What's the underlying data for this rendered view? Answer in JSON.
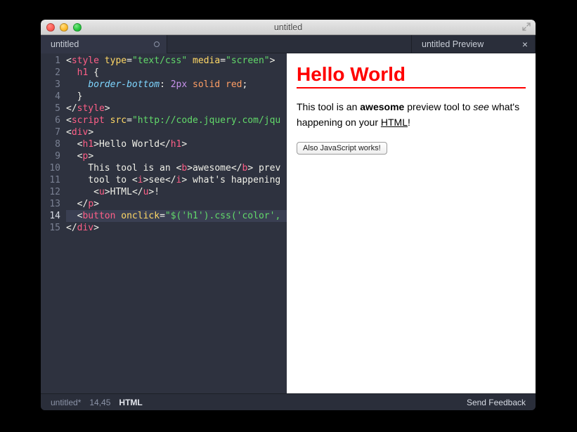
{
  "window": {
    "title": "untitled"
  },
  "tabs": {
    "left": {
      "label": "untitled",
      "dirty": true
    },
    "right": {
      "label": "untitled Preview"
    }
  },
  "editor": {
    "current_line": 14,
    "lines": [
      {
        "n": "1",
        "seg": [
          [
            "ang",
            "<"
          ],
          [
            "tag",
            "style"
          ],
          [
            "text",
            " "
          ],
          [
            "attr",
            "type"
          ],
          [
            "ang",
            "="
          ],
          [
            "str",
            "\"text/css\""
          ],
          [
            "text",
            " "
          ],
          [
            "attr",
            "media"
          ],
          [
            "ang",
            "="
          ],
          [
            "str",
            "\"screen\""
          ],
          [
            "ang",
            ">"
          ]
        ]
      },
      {
        "n": "2",
        "seg": [
          [
            "text",
            "  "
          ],
          [
            "tag",
            "h1"
          ],
          [
            "text",
            " {"
          ]
        ]
      },
      {
        "n": "3",
        "seg": [
          [
            "text",
            "    "
          ],
          [
            "prop",
            "border-bottom"
          ],
          [
            "text",
            ": "
          ],
          [
            "num",
            "2px"
          ],
          [
            "text",
            " "
          ],
          [
            "key",
            "solid"
          ],
          [
            "text",
            " "
          ],
          [
            "key",
            "red"
          ],
          [
            "text",
            ";"
          ]
        ]
      },
      {
        "n": "4",
        "seg": [
          [
            "text",
            "  }"
          ]
        ]
      },
      {
        "n": "5",
        "seg": [
          [
            "ang",
            "</"
          ],
          [
            "tag",
            "style"
          ],
          [
            "ang",
            ">"
          ]
        ]
      },
      {
        "n": "6",
        "seg": [
          [
            "ang",
            "<"
          ],
          [
            "tag",
            "script"
          ],
          [
            "text",
            " "
          ],
          [
            "attr",
            "src"
          ],
          [
            "ang",
            "="
          ],
          [
            "str",
            "\"http://code.jquery.com/jqu"
          ]
        ]
      },
      {
        "n": "7",
        "seg": [
          [
            "ang",
            "<"
          ],
          [
            "tag",
            "div"
          ],
          [
            "ang",
            ">"
          ]
        ]
      },
      {
        "n": "8",
        "seg": [
          [
            "text",
            "  "
          ],
          [
            "ang",
            "<"
          ],
          [
            "tag",
            "h1"
          ],
          [
            "ang",
            ">"
          ],
          [
            "text",
            "Hello World"
          ],
          [
            "ang",
            "</"
          ],
          [
            "tag",
            "h1"
          ],
          [
            "ang",
            ">"
          ]
        ]
      },
      {
        "n": "9",
        "seg": [
          [
            "text",
            "  "
          ],
          [
            "ang",
            "<"
          ],
          [
            "tag",
            "p"
          ],
          [
            "ang",
            ">"
          ]
        ]
      },
      {
        "n": "10",
        "seg": [
          [
            "text",
            "    This tool is an "
          ],
          [
            "ang",
            "<"
          ],
          [
            "tag",
            "b"
          ],
          [
            "ang",
            ">"
          ],
          [
            "text",
            "awesome"
          ],
          [
            "ang",
            "</"
          ],
          [
            "tag",
            "b"
          ],
          [
            "ang",
            ">"
          ],
          [
            "text",
            " prev"
          ]
        ]
      },
      {
        "n": "11",
        "seg": [
          [
            "text",
            "    tool to "
          ],
          [
            "ang",
            "<"
          ],
          [
            "tag",
            "i"
          ],
          [
            "ang",
            ">"
          ],
          [
            "text",
            "see"
          ],
          [
            "ang",
            "</"
          ],
          [
            "tag",
            "i"
          ],
          [
            "ang",
            ">"
          ],
          [
            "text",
            " what's happening"
          ]
        ]
      },
      {
        "n": "12",
        "seg": [
          [
            "text",
            "     "
          ],
          [
            "ang",
            "<"
          ],
          [
            "tag",
            "u"
          ],
          [
            "ang",
            ">"
          ],
          [
            "text",
            "HTML"
          ],
          [
            "ang",
            "</"
          ],
          [
            "tag",
            "u"
          ],
          [
            "ang",
            ">"
          ],
          [
            "text",
            "!"
          ]
        ]
      },
      {
        "n": "13",
        "seg": [
          [
            "text",
            "  "
          ],
          [
            "ang",
            "</"
          ],
          [
            "tag",
            "p"
          ],
          [
            "ang",
            ">"
          ]
        ]
      },
      {
        "n": "14",
        "seg": [
          [
            "text",
            "  "
          ],
          [
            "ang",
            "<"
          ],
          [
            "tag",
            "button"
          ],
          [
            "text",
            " "
          ],
          [
            "attr",
            "onclick"
          ],
          [
            "ang",
            "="
          ],
          [
            "str",
            "\"$('h1').css('color',"
          ]
        ]
      },
      {
        "n": "15",
        "seg": [
          [
            "ang",
            "</"
          ],
          [
            "tag",
            "div"
          ],
          [
            "ang",
            ">"
          ]
        ]
      }
    ]
  },
  "preview": {
    "heading": "Hello World",
    "p_pre": "This tool is an ",
    "p_bold": "awesome",
    "p_mid": " preview tool to ",
    "p_italic": "see",
    "p_mid2": " what's happening on your ",
    "p_underline": "HTML",
    "p_end": "!",
    "button": "Also JavaScript works!"
  },
  "status": {
    "filename": "untitled*",
    "position": "14,45",
    "language": "HTML",
    "feedback": "Send Feedback"
  }
}
